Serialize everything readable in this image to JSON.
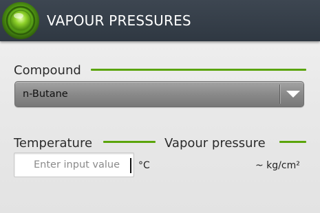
{
  "header": {
    "title": "VAPOUR PRESSURES",
    "icon": "green-orb-icon",
    "background_color": "#343d47"
  },
  "compound": {
    "label": "Compound",
    "selected": "n-Butane"
  },
  "temperature": {
    "label": "Temperature",
    "placeholder": "Enter input value",
    "unit": "°C"
  },
  "vapour_pressure": {
    "label": "Vapour pressure",
    "value_prefix": "~",
    "unit": "kg/cm²",
    "display": "~ kg/cm²"
  },
  "colors": {
    "accent_rule": "#5aa40a",
    "spinner": "#8c8c8c"
  }
}
